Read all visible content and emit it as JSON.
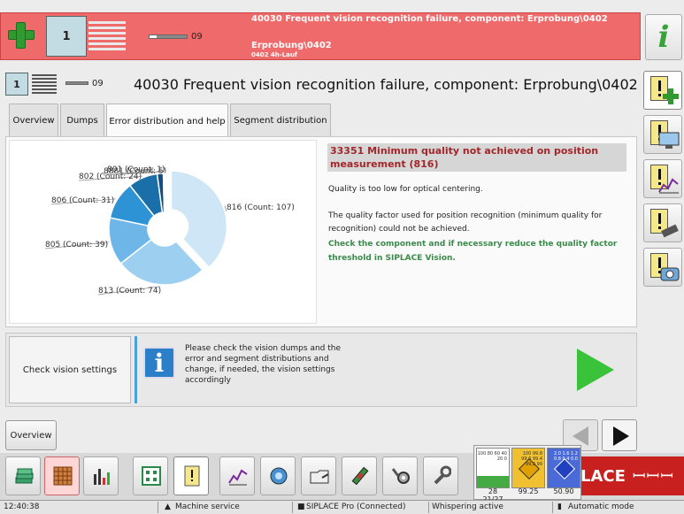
{
  "alarm_bar": {
    "counter": "1",
    "count": "09",
    "title": "40030 Frequent vision recognition failure, component: Erprobung\\0402",
    "sub1": "Erprobung\\0402",
    "sub2": "0402 4h-Lauf"
  },
  "header": {
    "counter": "1",
    "count": "09",
    "title": "40030 Frequent vision recognition failure, component: Erprobung\\0402"
  },
  "tabs": [
    {
      "label": "Overview"
    },
    {
      "label": "Dumps"
    },
    {
      "label": "Error distribution and help"
    },
    {
      "label": "Segment distribution"
    }
  ],
  "chart_data": {
    "type": "pie",
    "title": "",
    "slices": [
      {
        "label": "816 (Count: 107)",
        "value": 107,
        "color": "#cfe6f6"
      },
      {
        "label": "813 (Count: 74)",
        "value": 74,
        "color": "#9ccff0"
      },
      {
        "label": "805 (Count: 39)",
        "value": 39,
        "color": "#6fb6e8"
      },
      {
        "label": "806 (Count: 31)",
        "value": 31,
        "color": "#2d93d4"
      },
      {
        "label": "802 (Count: 24)",
        "value": 24,
        "color": "#1b6fa8"
      },
      {
        "label": "8881 (Count: 5)",
        "value": 5,
        "color": "#124f7e"
      },
      {
        "label": "801 (Count: 1)",
        "value": 1,
        "color": "#0c3a5e"
      }
    ]
  },
  "help": {
    "title": "33351 Minimum quality not achieved on position measurement (816)",
    "p1": "Quality is too low for optical centering.",
    "p2": "The quality factor used for position recognition (minimum quality for recognition) could not be achieved.",
    "p3": "Check the component and if necessary reduce the quality factor threshold in SIPLACE Vision."
  },
  "suggestion": {
    "button": "Check vision settings",
    "text": "Please check the vision dumps and the error and segment distributions and change, if needed, the vision settings accordingly"
  },
  "nav": {
    "overview": "Overview"
  },
  "brand": "LACE",
  "gauges": [
    {
      "value": "28",
      "sub": "21/27",
      "scale": "100 80 60 40 20 0"
    },
    {
      "value": "99.25",
      "scale": "100 99.8 99.6 99.4 99.2 99"
    },
    {
      "value": "50.90",
      "scale": "2.0 1.6 1.2 0.8 0.4 0.0"
    }
  ],
  "status": {
    "time": "12:40:38",
    "mode": "Machine service",
    "connection": "SIPLACE Pro (Connected)",
    "whisper": "Whispering active",
    "auto": "Automatic mode"
  },
  "colors": {
    "alarm": "#ef6a6a",
    "help_title": "#a2272a",
    "help_action": "#3a8b4a",
    "brand": "#c8201e"
  }
}
